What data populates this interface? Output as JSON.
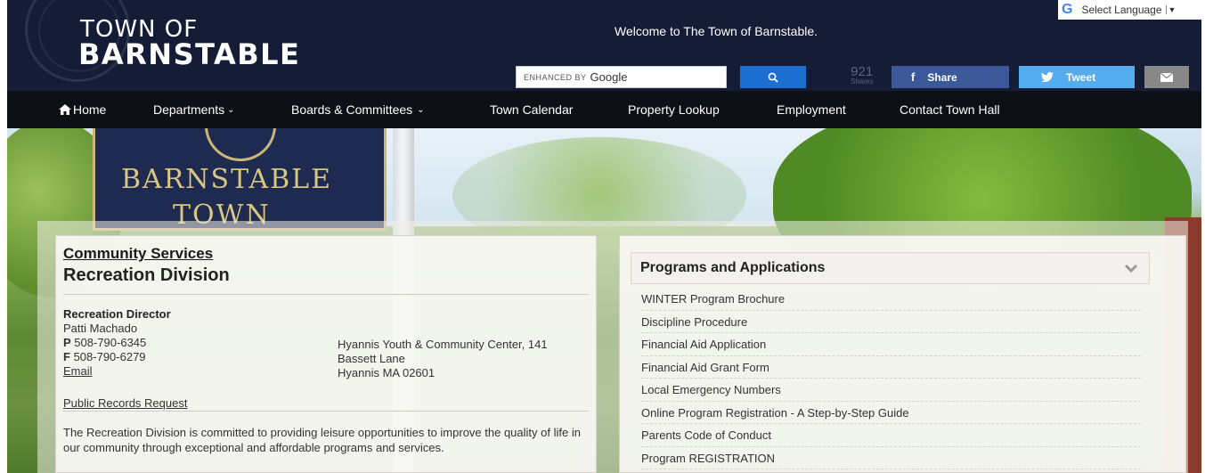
{
  "header": {
    "logo_top": "TOWN OF",
    "logo_main": "BARNSTABLE",
    "welcome": "Welcome to The Town of Barnstable.",
    "search": {
      "enhanced_by": "ENHANCED BY",
      "google": "Google"
    },
    "shares": {
      "count": "921",
      "label": "Shares"
    },
    "share_label": "Share",
    "tweet_label": "Tweet",
    "language": "Select Language"
  },
  "nav": {
    "home": "Home",
    "departments": "Departments",
    "boards": "Boards & Committees",
    "calendar": "Town Calendar",
    "property": "Property Lookup",
    "employment": "Employment",
    "contact": "Contact Town Hall"
  },
  "hero": {
    "sign_line1": "BARNSTABLE",
    "sign_line2": "TOWN"
  },
  "left": {
    "dept": "Community Services",
    "division": "Recreation Division",
    "role": "Recreation Director",
    "name": "Patti Machado",
    "phone_label": "P",
    "phone": "508-790-6345",
    "fax_label": "F",
    "fax": "508-790-6279",
    "email": "Email",
    "address1": "Hyannis Youth & Community Center, 141",
    "address2": "Bassett Lane",
    "address3": "Hyannis MA 02601",
    "public_records": "Public Records Request",
    "mission": "The Recreation Division is committed to providing leisure opportunities to improve the quality of life in our community through exceptional and affordable programs and services."
  },
  "right": {
    "title": "Programs and Applications",
    "items": [
      "WINTER Program Brochure",
      "Discipline Procedure",
      "Financial Aid Application",
      "Financial Aid Grant Form",
      "Local Emergency Numbers",
      "Online Program Registration - A Step-by-Step Guide",
      "Parents Code of Conduct",
      "Program REGISTRATION"
    ]
  },
  "colors": {
    "header_bg": "#151d36",
    "nav_bg": "#0d1015",
    "search_btn": "#1c6fd0",
    "facebook": "#3b5998",
    "twitter": "#55acee",
    "mail": "#888888"
  },
  "icons": [
    "search-icon",
    "facebook-icon",
    "twitter-icon",
    "mail-icon",
    "home-icon",
    "chevron-down-icon",
    "google-g-icon"
  ]
}
